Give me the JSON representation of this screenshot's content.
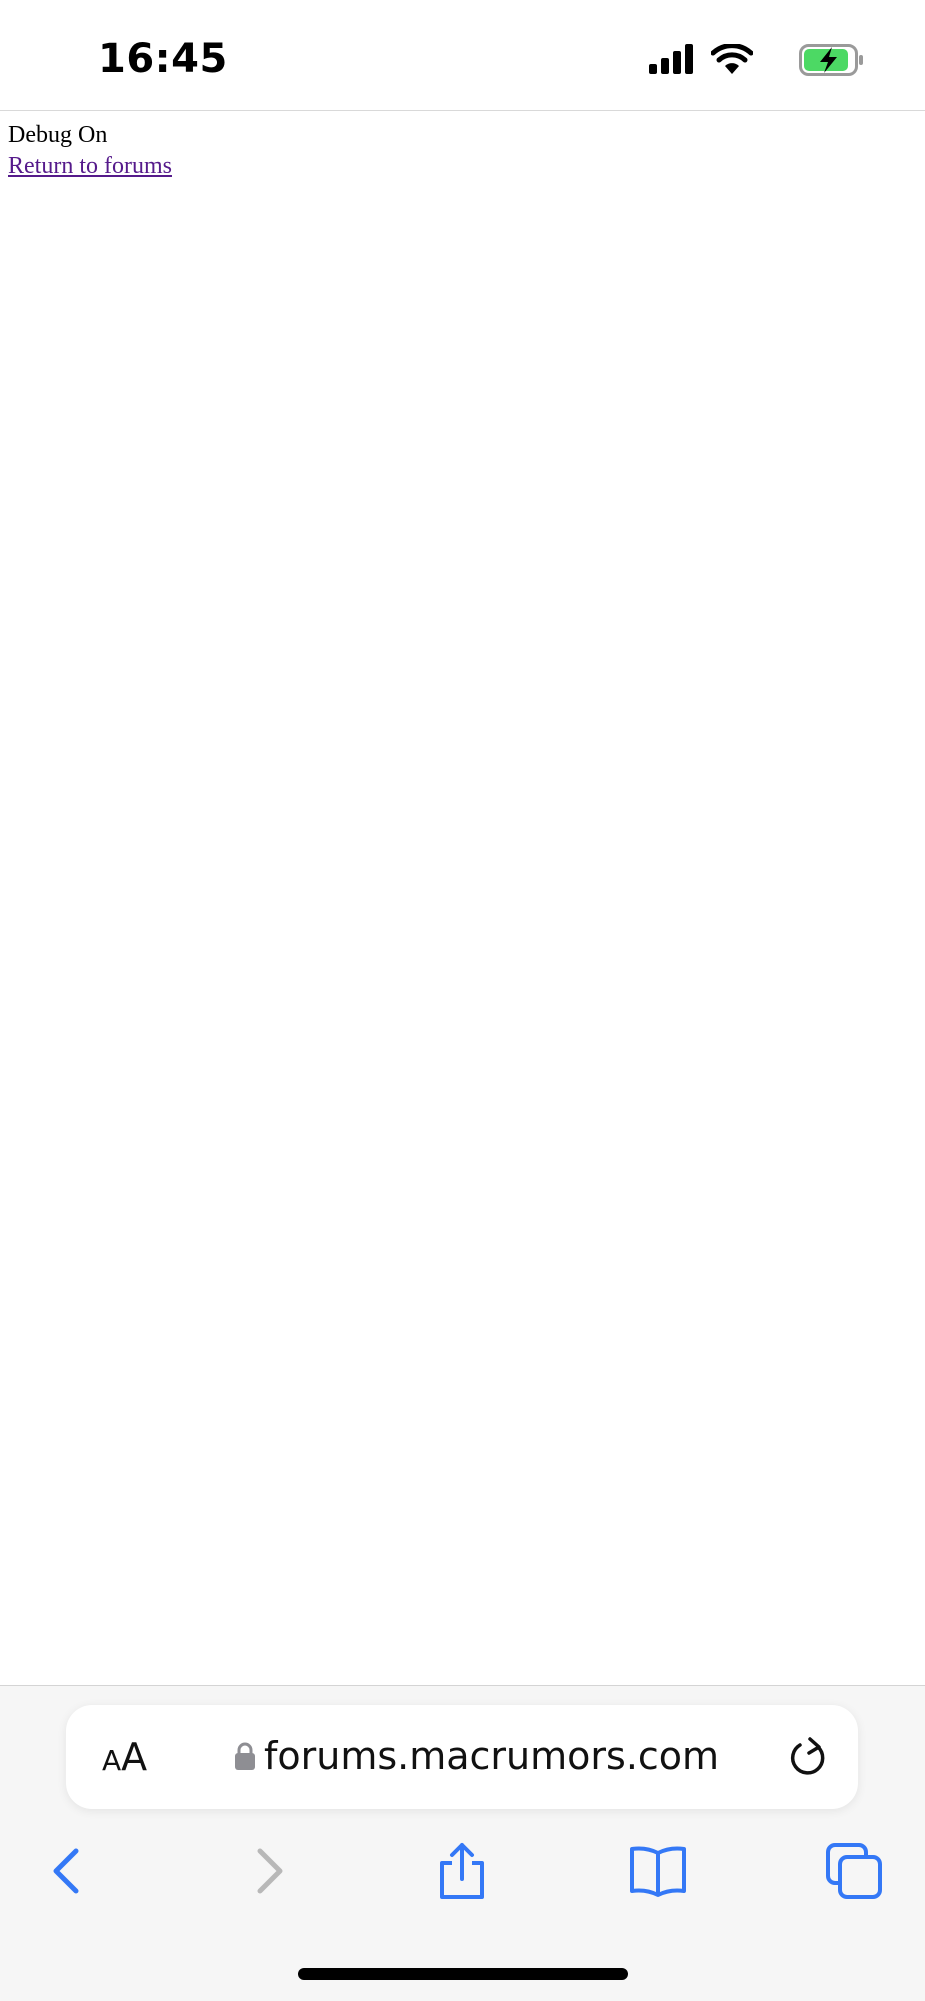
{
  "status_bar": {
    "time": "16:45",
    "icons": [
      "cellular-signal-icon",
      "wifi-icon",
      "battery-charging-icon"
    ]
  },
  "page": {
    "debug_text": "Debug On",
    "return_link": "Return to forums",
    "link_color": "#551a8b"
  },
  "address_bar": {
    "aa_small": "A",
    "aa_large": "A",
    "url": "forums.macrumors.com",
    "secure": true
  },
  "toolbar": {
    "items": [
      "back-icon",
      "forward-icon",
      "share-icon",
      "bookmarks-icon",
      "tabs-icon"
    ],
    "accent_color": "#3478f6",
    "disabled_color": "#b8b8b8"
  }
}
